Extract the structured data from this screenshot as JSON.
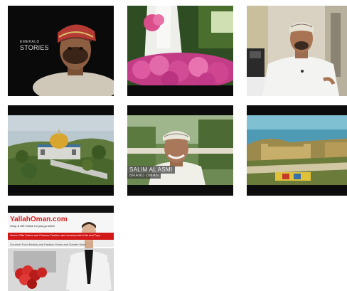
{
  "video_grid": {
    "items": [
      {
        "id": "video-1",
        "overlay_small": "EMERALD",
        "overlay_big": "STORIES"
      },
      {
        "id": "video-2"
      },
      {
        "id": "video-3"
      },
      {
        "id": "video-4"
      },
      {
        "id": "video-5",
        "lower_third_name": "SALIM AL ASMI",
        "lower_third_role": "BRAND OMAN"
      },
      {
        "id": "video-6"
      },
      {
        "id": "video-7",
        "site_logo": "YallahOman.com",
        "site_tagline": "Shop & Gift Online for just go better",
        "site_nav": "Home    Gifts Cakes and Flowers    Fashion and Accessories    Kids and Toys",
        "site_subnav": "Gourmet Food    Beauty and Fashion    Home and Garden    More"
      }
    ]
  }
}
